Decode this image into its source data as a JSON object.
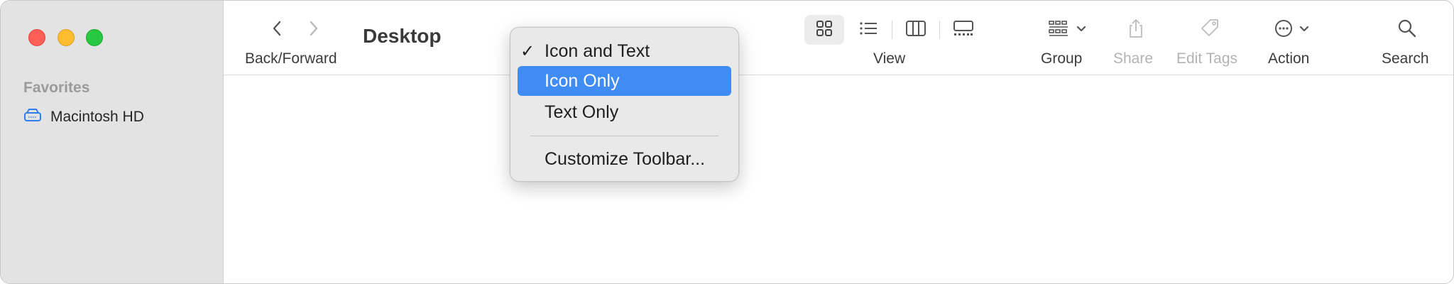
{
  "window": {
    "title": "Desktop"
  },
  "sidebar": {
    "heading": "Favorites",
    "items": [
      {
        "label": "Macintosh HD",
        "icon": "drive-icon"
      }
    ]
  },
  "toolbar": {
    "back_forward_label": "Back/Forward",
    "view_label": "View",
    "group_label": "Group",
    "share_label": "Share",
    "edit_tags_label": "Edit Tags",
    "action_label": "Action",
    "search_label": "Search",
    "view_modes": [
      "icon-view",
      "list-view",
      "column-view",
      "gallery-view"
    ],
    "active_view": "icon-view"
  },
  "menu": {
    "items": [
      {
        "label": "Icon and Text",
        "checked": true,
        "highlighted": false
      },
      {
        "label": "Icon Only",
        "checked": false,
        "highlighted": true
      },
      {
        "label": "Text Only",
        "checked": false,
        "highlighted": false
      },
      {
        "label": "Customize Toolbar...",
        "checked": false,
        "highlighted": false
      }
    ],
    "check_glyph": "✓"
  },
  "colors": {
    "accent": "#3f8cf4",
    "sidebar_bg": "#e3e3e3",
    "close": "#ff5f57",
    "minimize": "#febc2e",
    "zoom": "#28c840"
  }
}
